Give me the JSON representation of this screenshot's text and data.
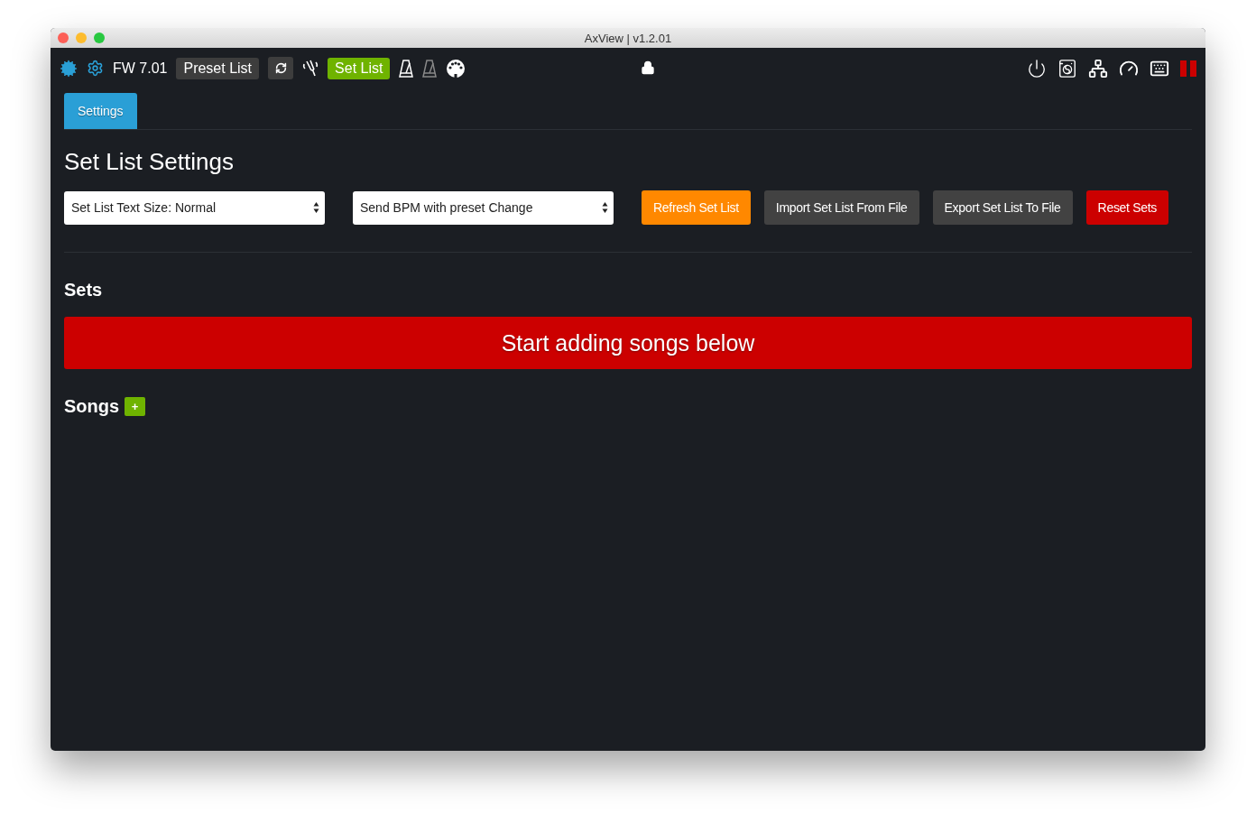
{
  "window": {
    "title": "AxView | v1.2.01"
  },
  "toolbar": {
    "firmware": "FW 7.01",
    "nav": [
      {
        "label": "Preset List",
        "selected": false
      },
      {
        "label": "Set List",
        "selected": true
      }
    ]
  },
  "tabs": [
    {
      "label": "Settings",
      "selected": true
    }
  ],
  "settings": {
    "title": "Set List Settings",
    "selects": [
      {
        "value": "Set List Text Size: Normal"
      },
      {
        "value": "Send BPM with preset Change"
      }
    ],
    "buttons": [
      {
        "label": "Refresh Set List",
        "kind": "warning"
      },
      {
        "label": "Import Set List From File",
        "kind": "default"
      },
      {
        "label": "Export Set List To File",
        "kind": "default"
      },
      {
        "label": "Reset Sets",
        "kind": "danger"
      }
    ]
  },
  "sets": {
    "title": "Sets",
    "banner": "Start adding songs below"
  },
  "songs": {
    "title": "Songs",
    "add": "+"
  }
}
